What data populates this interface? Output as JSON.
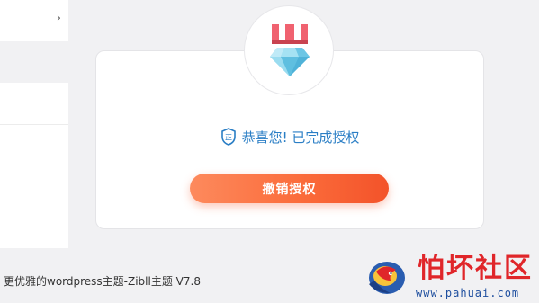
{
  "sidebar": {
    "chevron_glyph": "›"
  },
  "license": {
    "success_message": "恭喜您! 已完成授权",
    "revoke_button": "撤销授权"
  },
  "footer": {
    "text": "更优雅的wordpress主题-Zibll主题 V7.8"
  },
  "watermark": {
    "title": "怕坏社区",
    "url": "www.pahuai.com"
  },
  "colors": {
    "accent": "#2a7ec5",
    "button": "#fb6c3b",
    "brand_red": "#e0262a"
  },
  "icons": {
    "badge": "diamond-medal-icon",
    "status": "shield-check-icon",
    "nav": "chevron-right-icon"
  }
}
